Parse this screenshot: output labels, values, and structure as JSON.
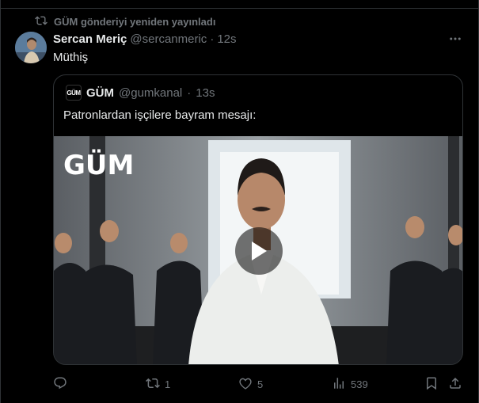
{
  "retweet": {
    "text": "GÜM gönderiyi yeniden yayınladı",
    "icon": "retweet-icon"
  },
  "tweet": {
    "author_name": "Sercan Meriç",
    "handle": "@sercanmeric",
    "separator": "·",
    "time": "12s",
    "text": "Müthiş"
  },
  "quote": {
    "logo_text": "GÜM",
    "author_name": "GÜM",
    "handle": "@gumkanal",
    "separator": "·",
    "time": "13s",
    "text": "Patronlardan işçilere bayram mesajı:",
    "video_watermark": "GÜM"
  },
  "actions": {
    "reply_count": "",
    "retweet_count": "1",
    "like_count": "5",
    "views_count": "539"
  },
  "colors": {
    "background": "#000000",
    "muted": "#71767b",
    "text": "#e7e9ea",
    "border": "#2f3336"
  }
}
